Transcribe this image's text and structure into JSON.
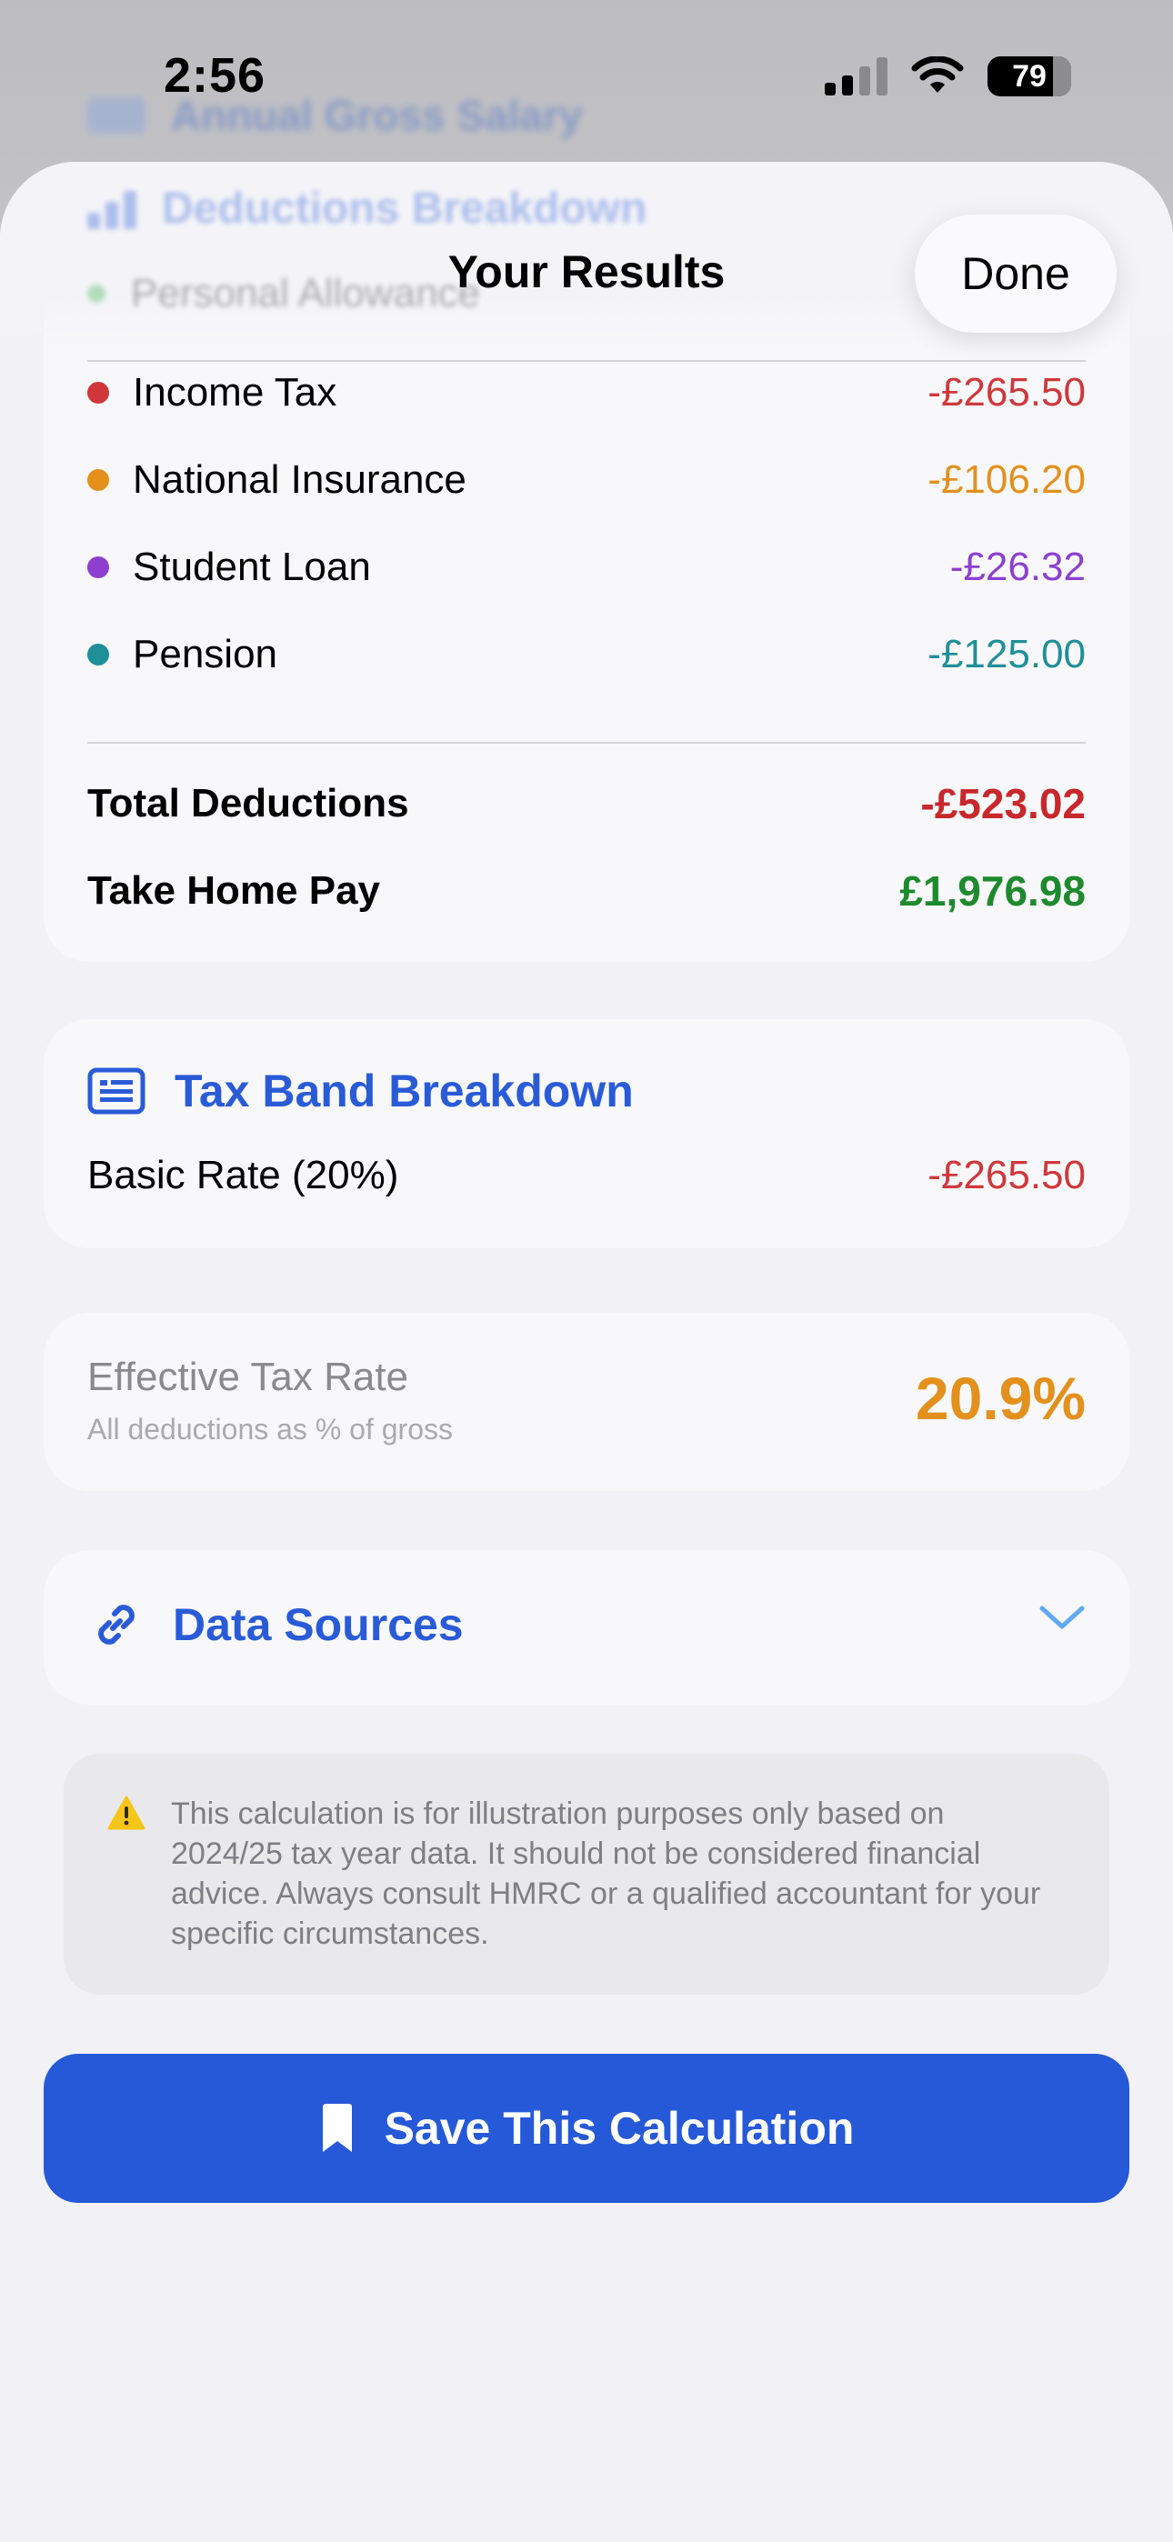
{
  "status": {
    "time": "2:56",
    "battery": "79"
  },
  "background": {
    "annual_label": "Annual Gross Salary",
    "breakdown_label": "Deductions Breakdown",
    "personal_allowance": "Personal Allowance"
  },
  "sheet": {
    "title": "Your Results",
    "done_label": "Done"
  },
  "deductions": {
    "items": [
      {
        "label": "Income Tax",
        "value": "-£265.50",
        "color": "#d0373a"
      },
      {
        "label": "National Insurance",
        "value": "-£106.20",
        "color": "#e3901c"
      },
      {
        "label": "Student Loan",
        "value": "-£26.32",
        "color": "#8d3fcf"
      },
      {
        "label": "Pension",
        "value": "-£125.00",
        "color": "#1f8f98"
      }
    ],
    "total_label": "Total Deductions",
    "total_value": "-£523.02",
    "total_color": "#c8282c",
    "takehome_label": "Take Home Pay",
    "takehome_value": "£1,976.98",
    "takehome_color": "#1e8a2e"
  },
  "tax_band": {
    "title": "Tax Band Breakdown",
    "row_label": "Basic Rate (20%)",
    "row_value": "-£265.50"
  },
  "effective_rate": {
    "label": "Effective Tax Rate",
    "subtitle": "All deductions as % of gross",
    "value": "20.9%"
  },
  "data_sources": {
    "title": "Data Sources"
  },
  "disclaimer": {
    "text": "This calculation is for illustration purposes only based on 2024/25 tax year data. It should not be considered financial advice. Always consult HMRC or a qualified accountant for your specific circumstances."
  },
  "save": {
    "label": "Save This Calculation"
  },
  "colors": {
    "accent": "#2a5bd7",
    "button": "#2659d8"
  },
  "icons": {
    "tax_band": "list-document-icon",
    "sources": "link-icon",
    "chevron": "chevron-down-icon",
    "warning": "warning-triangle-icon",
    "save": "bookmark-icon"
  }
}
